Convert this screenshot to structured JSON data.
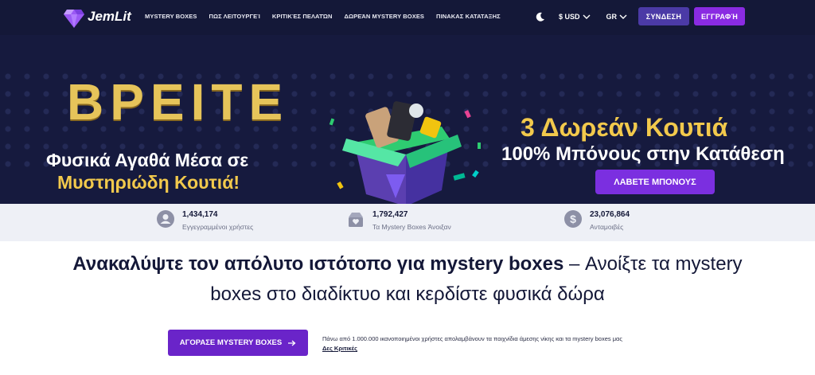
{
  "nav": {
    "logo_text": "JemLit",
    "links": [
      "MYSTERY BOXES",
      "ΠΩΣ ΛΕΙΤΟΥΡΓΕΊ",
      "ΚΡΙΤΙΚΈΣ ΠΕΛΑΤΏΝ",
      "ΔΩΡΕΆΝ MYSTERY BOXES",
      "ΠΙΝΑΚΑΣ ΚΑΤΑΤΑΞΗΣ"
    ],
    "currency": "$ USD",
    "language": "GR",
    "login_label": "ΣΥΝΔΕΣΗ",
    "signup_label": "ΕΓΓΡΑΦΉ"
  },
  "hero": {
    "big_word": "ΒΡΕΙΤΕ",
    "line2": "Φυσικά Αγαθά Μέσα σε",
    "line3": "Μυστηριώδη Κουτιά!",
    "right_title": "3 Δωρεάν Κουτιά",
    "right_subtitle": "100% Μπόνους στην Κατάθεση",
    "cta_label": "ΛΑΒΕΤΕ ΜΠΟΝΟΥΣ"
  },
  "stats": [
    {
      "icon": "user-icon",
      "value": "1,434,174",
      "label": "Εγγεγραμμένοι χρήστες"
    },
    {
      "icon": "box-icon",
      "value": "1,792,427",
      "label": "Τα Mystery Boxes Άνοιξαν"
    },
    {
      "icon": "dollar-icon",
      "value": "23,076,864",
      "label": "Ανταμοιβές"
    }
  ],
  "headline": {
    "bold_part": "Ανακαλύψτε τον απόλυτο ιστότοπο για mystery boxes",
    "line1_rest": " – Ανοίξτε τα mystery",
    "line2": "boxes στο διαδίκτυο και κερδίστε φυσικά δώρα"
  },
  "cta": {
    "label": "ΑΓΟΡΑΣΕ MYSTERY BOXES",
    "trust_text": "Πάνω από 1.000.000 ικανοποιημένοι χρήστες απολαμβάνουν τα παιχνίδια άμεσης νίκης και τα mystery boxes μας",
    "reviews_link": "Δες Κριτικές"
  },
  "colors": {
    "nav_bg": "#141838",
    "accent_purple": "#7b2fe0",
    "gold": "#f2c94c"
  }
}
